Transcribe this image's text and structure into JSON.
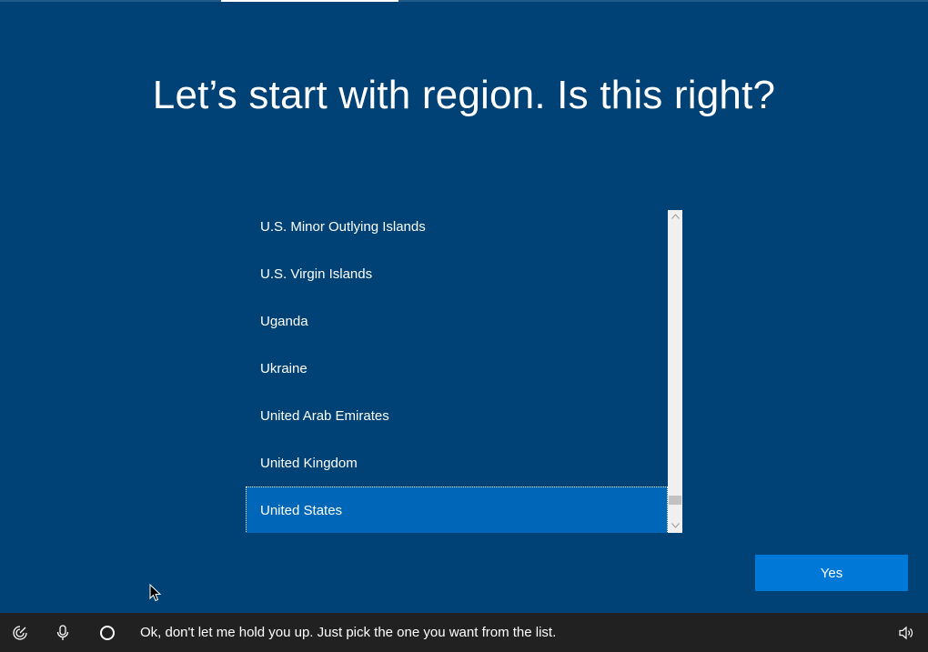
{
  "progress": {
    "step_fraction": 0.19
  },
  "heading": "Let’s start with region. Is this right?",
  "region_list": {
    "items": [
      "U.S. Minor Outlying Islands",
      "U.S. Virgin Islands",
      "Uganda",
      "Ukraine",
      "United Arab Emirates",
      "United Kingdom",
      "United States"
    ],
    "selected": "United States"
  },
  "scrollbar": {
    "up_icon": "chevron-up-icon",
    "down_icon": "chevron-down-icon"
  },
  "yes_button": {
    "label": "Yes"
  },
  "taskbar": {
    "accessibility_icon": "ease-of-access-icon",
    "microphone_icon": "microphone-icon",
    "cortana_icon": "cortana-ring-icon",
    "cortana_message": "Ok, don't let me hold you up. Just pick the one you want from the list.",
    "volume_icon": "speaker-icon"
  },
  "colors": {
    "background": "#004275",
    "selected_item": "#0067b8",
    "button": "#0078d7",
    "taskbar": "#212121"
  }
}
